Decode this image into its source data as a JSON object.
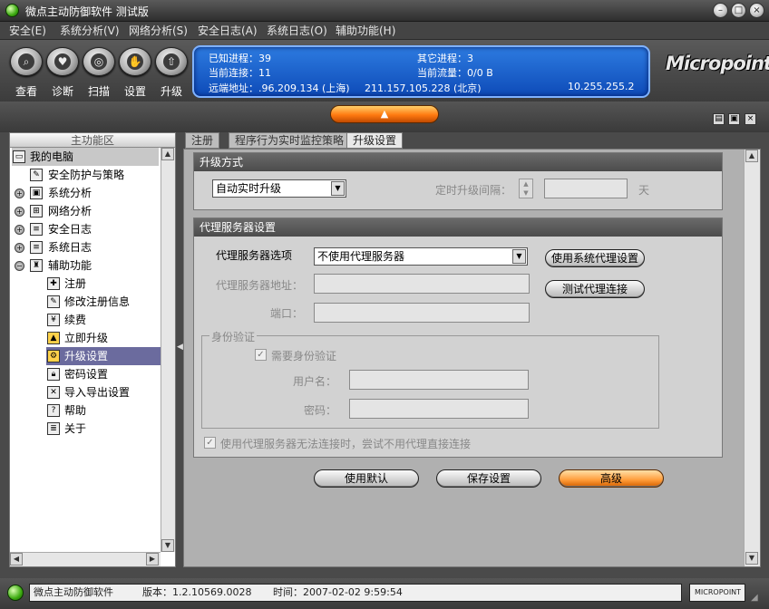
{
  "window": {
    "title": "微点主动防御软件  测试版"
  },
  "menu": [
    {
      "label": "安全(E)"
    },
    {
      "label": "系统分析(V)"
    },
    {
      "label": "网络分析(S)"
    },
    {
      "label": "安全日志(A)"
    },
    {
      "label": "系统日志(O)"
    },
    {
      "label": "辅助功能(H)"
    }
  ],
  "toolbar": [
    {
      "label": "查看",
      "icon": "magnifier-icon"
    },
    {
      "label": "诊断",
      "icon": "heart-shield-icon"
    },
    {
      "label": "扫描",
      "icon": "radar-icon"
    },
    {
      "label": "设置",
      "icon": "hand-icon"
    },
    {
      "label": "升级",
      "icon": "up-arrow-icon"
    }
  ],
  "info": {
    "known_processes": "已知进程：39",
    "other_processes": "其它进程：3",
    "current_connections": "当前连接：11",
    "current_traffic": "当前流量：0/0 B",
    "remote_label": "远端地址：.96.209.134 (上海)",
    "remote_addr2": "211.157.105.228 (北京)",
    "remote_addr3": "10.255.255.2"
  },
  "logo": "Micropoint",
  "left_pane": {
    "title": "主功能区",
    "items": [
      {
        "label": "我的电脑",
        "icon": "computer-icon"
      },
      {
        "label": "安全防护与策略",
        "icon": "policy-icon"
      },
      {
        "label": "系统分析",
        "icon": "system-icon"
      },
      {
        "label": "网络分析",
        "icon": "network-icon"
      },
      {
        "label": "安全日志",
        "icon": "security-log-icon"
      },
      {
        "label": "系统日志",
        "icon": "system-log-icon"
      },
      {
        "label": "辅助功能",
        "icon": "tools-icon"
      },
      {
        "label": "注册",
        "icon": "register-icon"
      },
      {
        "label": "修改注册信息",
        "icon": "edit-register-icon"
      },
      {
        "label": "续费",
        "icon": "renew-icon"
      },
      {
        "label": "立即升级",
        "icon": "upgrade-now-icon"
      },
      {
        "label": "升级设置",
        "icon": "upgrade-settings-icon"
      },
      {
        "label": "密码设置",
        "icon": "lock-icon"
      },
      {
        "label": "导入导出设置",
        "icon": "wrench-icon"
      },
      {
        "label": "帮助",
        "icon": "help-icon"
      },
      {
        "label": "关于",
        "icon": "about-icon"
      }
    ]
  },
  "tabs": [
    {
      "label": "注册"
    },
    {
      "label": "程序行为实时监控策略"
    },
    {
      "label": "升级设置"
    }
  ],
  "upgrade": {
    "header": "升级方式",
    "mode_value": "自动实时升级",
    "interval_label": "定时升级间隔：",
    "interval_unit": "天"
  },
  "proxy": {
    "header": "代理服务器设置",
    "option_label": "代理服务器选项",
    "option_value": "不使用代理服务器",
    "use_system_btn": "使用系统代理设置",
    "address_label": "代理服务器地址：",
    "test_btn": "测试代理连接",
    "port_label": "端口：",
    "auth_group": "身份验证",
    "need_auth": "需要身份验证",
    "username_label": "用户名：",
    "password_label": "密码：",
    "fallback": "使用代理服务器无法连接时，尝试不用代理直接连接"
  },
  "buttons": {
    "default": "使用默认",
    "save": "保存设置",
    "advanced": "高级"
  },
  "status": {
    "app": "微点主动防御软件",
    "version": "版本：1.2.10569.0028",
    "time": "时间：2007-02-02 9:59:54",
    "brand": "MICROPOINT"
  },
  "colors": {
    "selected_bg": "#6b6b9e",
    "accent_orange": "#ff8a1e",
    "info_blue": "#1a5fd0"
  }
}
